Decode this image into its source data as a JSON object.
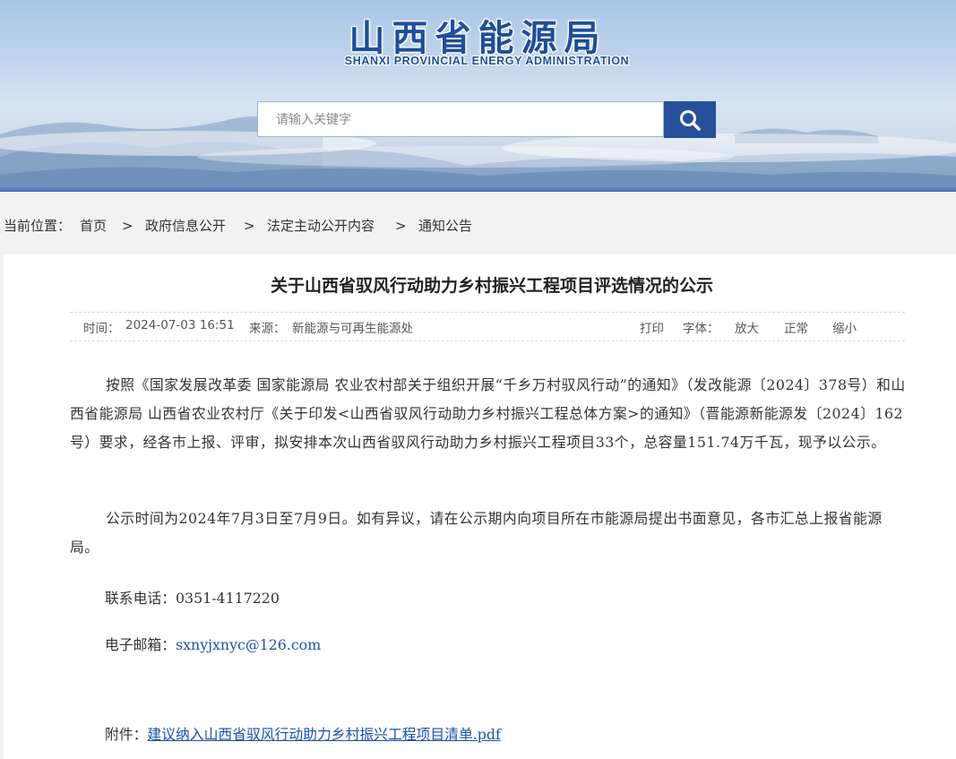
{
  "header": {
    "site_name_cn": "山西省能源局",
    "site_name_en": "SHANXI PROVINCIAL ENERGY ADMINISTRATION",
    "search": {
      "placeholder": "请输入关键字",
      "button_icon": "search-icon"
    }
  },
  "breadcrumb": {
    "label": "当前位置：",
    "items": [
      "首页",
      "政府信息公开",
      "法定主动公开内容",
      "通知公告"
    ],
    "separator": ">"
  },
  "article": {
    "title": "关于山西省驭风行动助力乡村振兴工程项目评选情况的公示",
    "meta": {
      "time_label": "时间：",
      "time_value": "2024-07-03 16:51",
      "source_label": "来源：",
      "source_value": "新能源与可再生能源处",
      "print": "打印",
      "font_label": "字体：",
      "font_large": "放大",
      "font_normal": "正常",
      "font_small": "缩小"
    },
    "paragraphs": [
      "按照《国家发展改革委 国家能源局 农业农村部关于组织开展“千乡万村驭风行动”的通知》（发改能源〔2024〕378号）和山西省能源局 山西省农业农村厅《关于印发<山西省驭风行动助力乡村振兴工程总体方案>的通知》（晋能源新能源发〔2024〕162号）要求，经各市上报、评审，拟安排本次山西省驭风行动助力乡村振兴工程项目33个，总容量151.74万千瓦，现予以公示。",
      "公示时间为2024年7月3日至7月9日。如有异议，请在公示期内向项目所在市能源局提出书面意见，各市汇总上报省能源局。"
    ],
    "phone_label": "联系电话：",
    "phone_value": "0351-4117220",
    "email_label": "电子邮箱：",
    "email_value": "sxnyjxnyc@126.com",
    "attachment_label": "附件：",
    "attachment_name": "建议纳入山西省驭风行动助力乡村振兴工程项目清单.pdf"
  },
  "colors": {
    "brand": "#1f4e9a",
    "search_button": "#25519a",
    "link": "#1a52a8"
  }
}
